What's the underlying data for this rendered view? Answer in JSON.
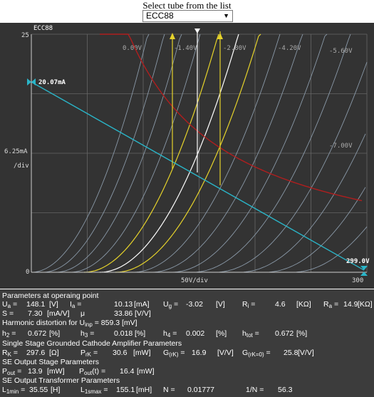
{
  "header": {
    "select_label": "Select tube from the list"
  },
  "tube_select": {
    "value": "ECC88",
    "arrow_icon": "triangle-down-icon"
  },
  "plot": {
    "tube_name": "ECC88",
    "y_top_label": "25",
    "y_mid_label": "6.25mA",
    "y_div_label": "/div",
    "y_zero_label": "0",
    "x_div_label": "50V/div",
    "x_max_label": "300",
    "ia_marker_label": "20.07mA",
    "ua_marker_label": "299.0V",
    "grid_labels": [
      "0.00V",
      "-1.40V",
      "-2.80V",
      "-4.20V",
      "-5.60V",
      "-7.00V"
    ],
    "colors": {
      "background": "#333333",
      "grid": "#666666",
      "curves": "#8a99a8",
      "highlight": "#e6d32b",
      "operating": "#ffffff",
      "load_line": "#2ab5c8",
      "max_power": "#b01e1e"
    }
  },
  "params": {
    "section_op": "Parameters at operaing point",
    "ua": {
      "label": "U",
      "sub": "a",
      "eq": "=",
      "value": "148.1",
      "unit": "[V]"
    },
    "ia": {
      "label": "I",
      "sub": "a",
      "eq": "=",
      "value": "10.13",
      "unit": "[mA]"
    },
    "ug": {
      "label": "U",
      "sub": "g",
      "eq": "=",
      "value": "-3.02",
      "unit": "[V]"
    },
    "ri": {
      "label": "R",
      "sub": "i",
      "eq": "=",
      "value": "4.6",
      "unit": "[KΩ]"
    },
    "ra": {
      "label": "R",
      "sub": "a",
      "eq": "=",
      "value": "14.9",
      "unit": "[KΩ]"
    },
    "s": {
      "label": "S",
      "eq": "=",
      "value": "7.30",
      "unit": "[mA/V]"
    },
    "mu": {
      "label": "μ",
      "value": "33.86",
      "unit": "[V/V]"
    },
    "harmonic": {
      "text": "Harmonic distortion for U",
      "sub": "inp",
      "eq": "=",
      "value": "859.3",
      "unit": "[mV]"
    },
    "h2": {
      "label": "h",
      "sub": "2",
      "eq": "=",
      "value": "0.672",
      "unit": "[%]"
    },
    "h3": {
      "label": "h",
      "sub": "3",
      "eq": "=",
      "value": "0.018",
      "unit": "[%]"
    },
    "h4": {
      "label": "h",
      "sub": "4",
      "eq": "=",
      "value": "0.002",
      "unit": "[%]"
    },
    "htot": {
      "label": "h",
      "sub": "tot",
      "eq": "=",
      "value": "0.672",
      "unit": "[%]"
    },
    "section_single": "Single Stage Grounded Cathode Amplifier Parameters",
    "rk": {
      "label": "R",
      "sub": "K",
      "eq": "=",
      "value": "297.6",
      "unit": "[Ω]"
    },
    "prk": {
      "label": "P",
      "sub": "rK",
      "eq": "=",
      "value": "30.6",
      "unit": "[mW]"
    },
    "grk": {
      "label": "G",
      "sub": "(rK)",
      "eq": "=",
      "value": "16.9",
      "unit": "[V/V]"
    },
    "grk0": {
      "label": "G",
      "sub": "(rK=0)",
      "eq": "=",
      "value": "25.8",
      "unit": "[V/V]"
    },
    "section_output": "SE Output Stage Parameters",
    "pout": {
      "label": "P",
      "sub": "out",
      "eq": "=",
      "value": "13.9",
      "unit": "[mW]"
    },
    "poutt": {
      "label": "P",
      "sub": "out",
      "label2": "(t)",
      "eq": "=",
      "value": "16.4",
      "unit": "[mW]"
    },
    "section_transformer": "SE Output Transformer Parameters",
    "l1min": {
      "label": "L",
      "sub": "1min",
      "eq": "=",
      "value": "35.55",
      "unit": "[H]"
    },
    "l1smax": {
      "label": "L",
      "sub": "1smax",
      "eq": "=",
      "value": "155.1",
      "unit": "[mH]"
    },
    "n": {
      "label": "N",
      "eq": "=",
      "value": "0.01777"
    },
    "inv_n": {
      "label": "1/N",
      "eq": "=",
      "value": "56.3"
    }
  }
}
